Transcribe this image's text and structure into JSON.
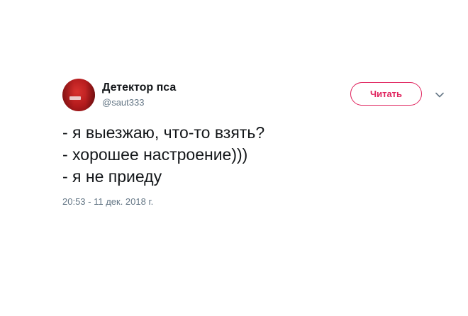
{
  "tweet": {
    "display_name": "Детектор пса",
    "handle": "@saut333",
    "follow_label": "Читать",
    "lines": [
      "- я выезжаю, что-то взять?",
      "- хорошее настроение)))",
      "- я не приеду"
    ],
    "timestamp": "20:53 - 11 дек. 2018 г."
  },
  "colors": {
    "accent": "#e0245e",
    "text": "#14171a",
    "muted": "#657786"
  },
  "icons": {
    "menu": "chevron-down-icon",
    "avatar": "avatar"
  }
}
